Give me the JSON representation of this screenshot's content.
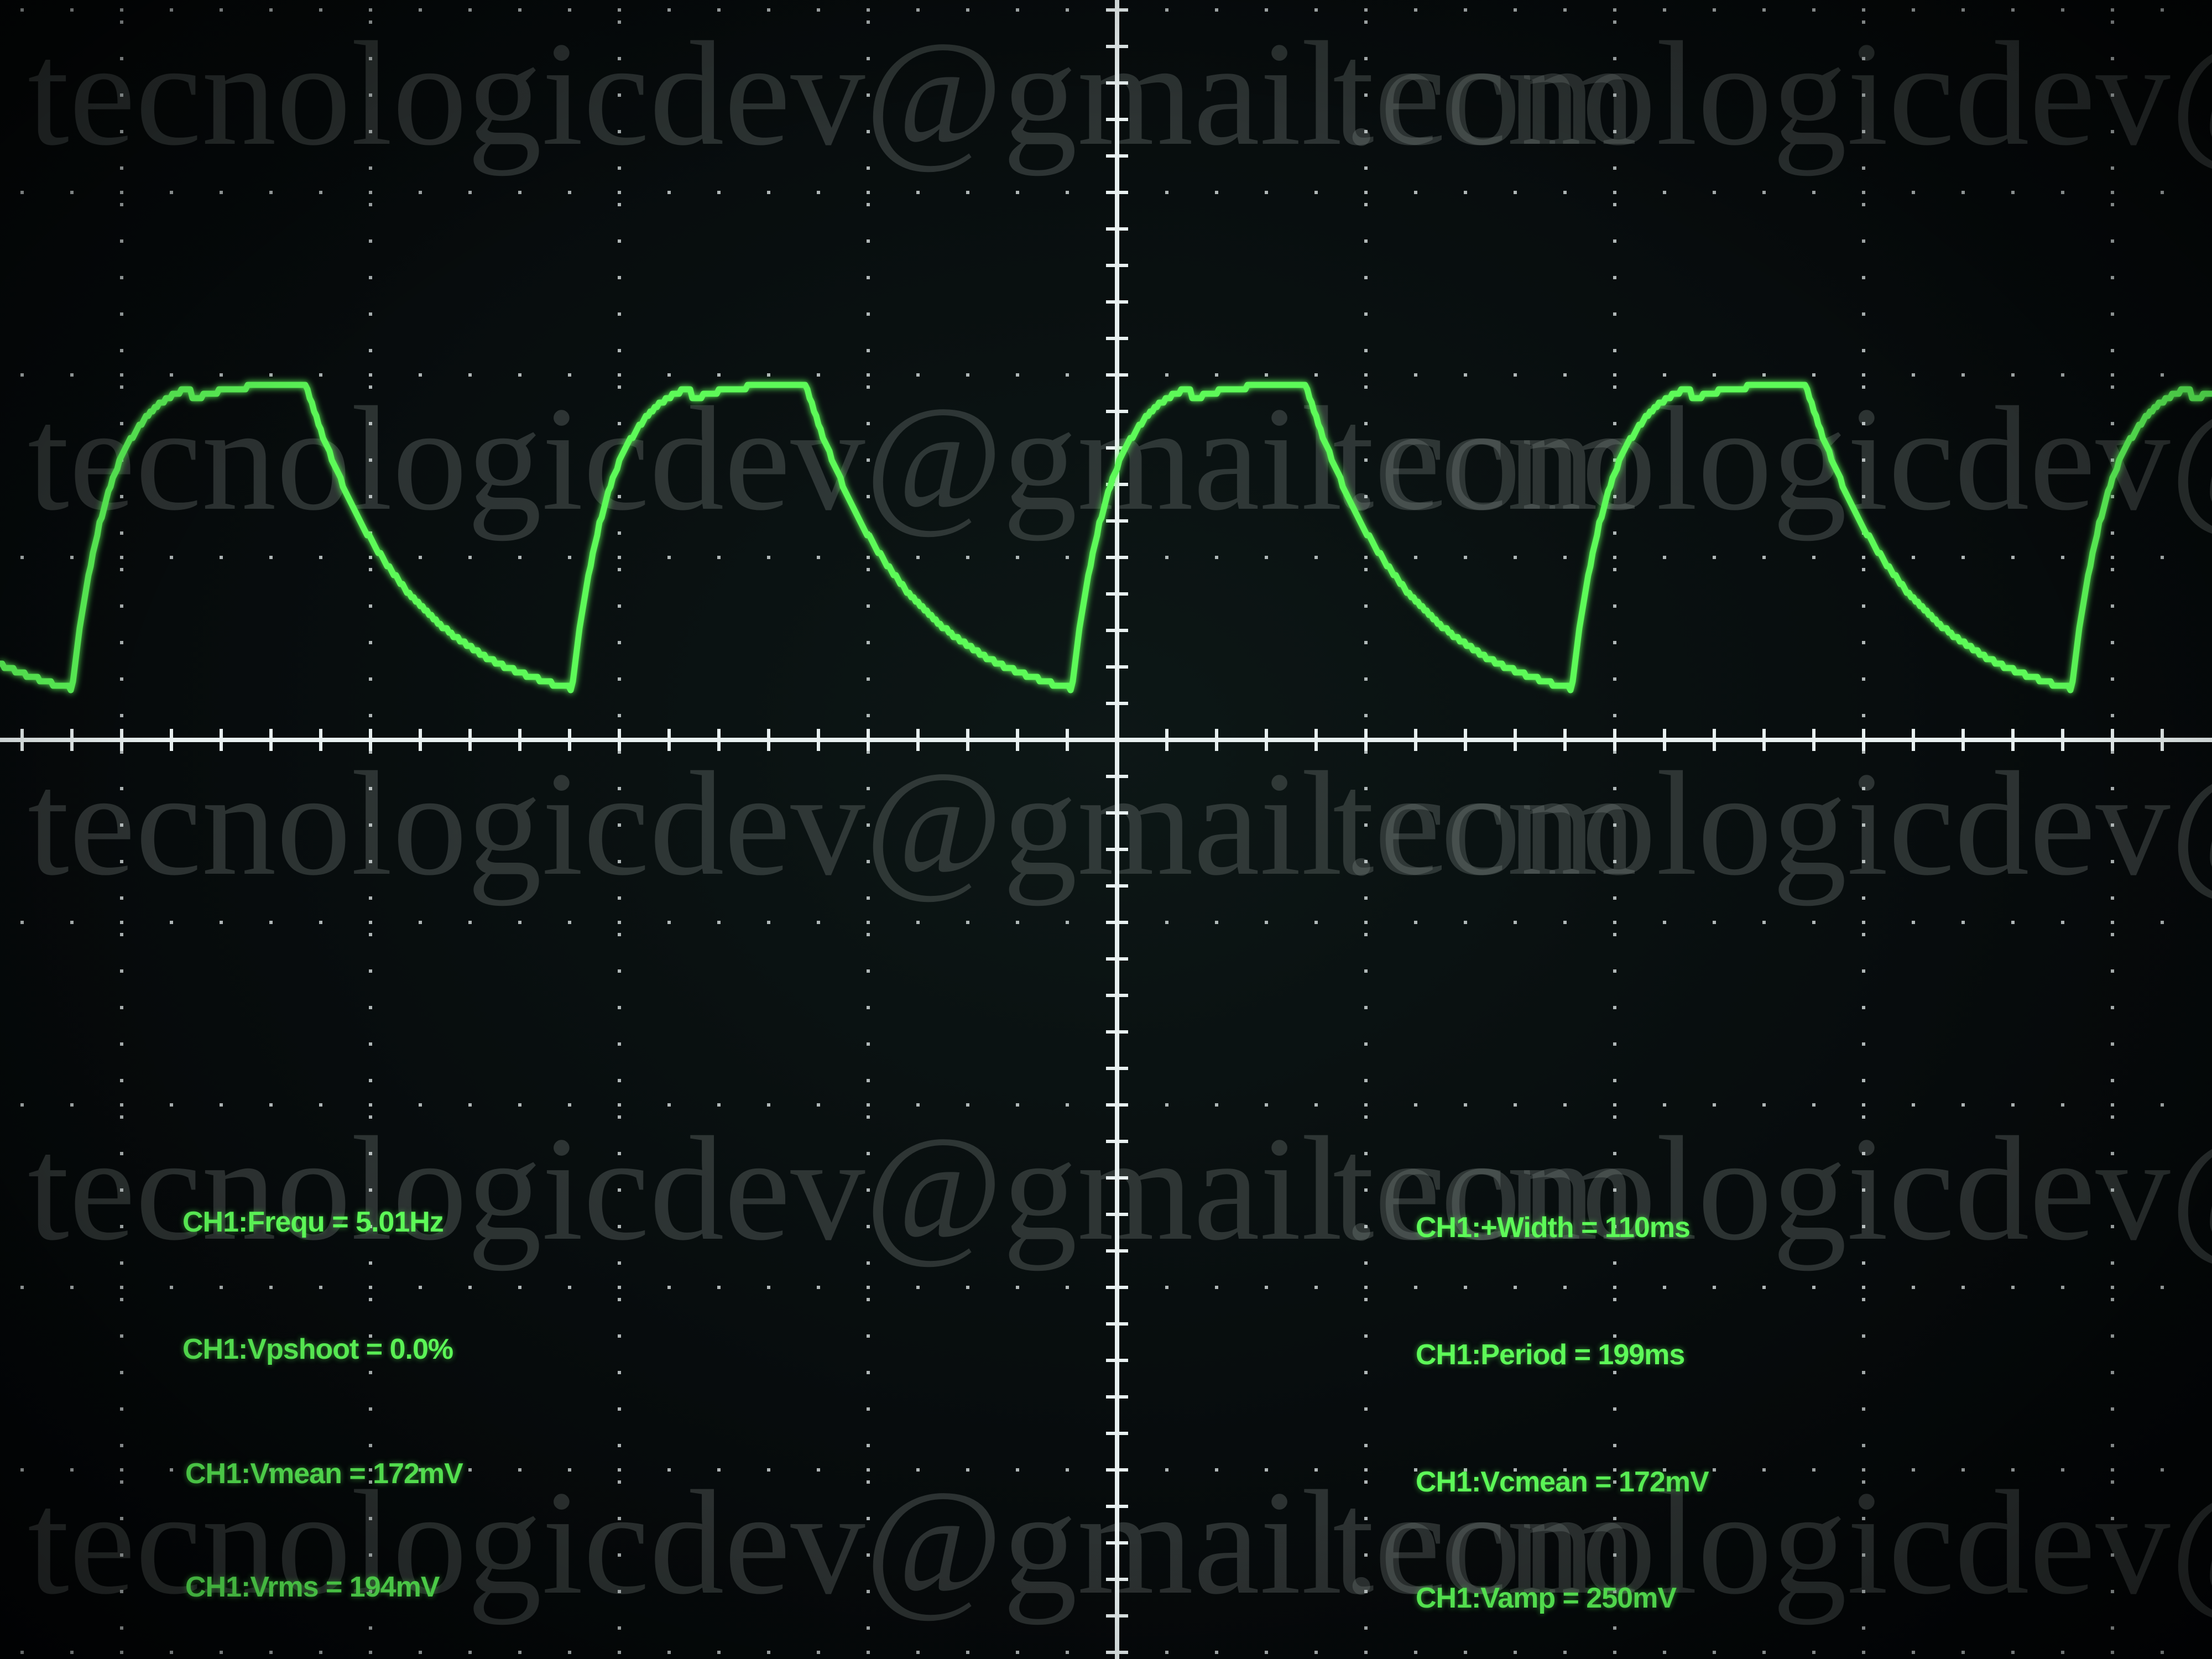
{
  "watermark": {
    "text_left": "tecnologicdev@gmail.com",
    "text_right": "tecnologicdev@gm"
  },
  "measurements": {
    "left": [
      {
        "label": "CH1:Frequ = 5.01Hz"
      },
      {
        "label": "CH1:Vpshoot = 0.0%"
      },
      {
        "label": "CH1:Vmean = 172mV"
      },
      {
        "label": "CH1:Vrms = 194mV"
      }
    ],
    "right": [
      {
        "label": "CH1:+Width = 110ms"
      },
      {
        "label": "CH1:Period = 199ms"
      },
      {
        "label": "CH1:Vcmean = 172mV"
      },
      {
        "label": "CH1:Vamp = 250mV"
      }
    ]
  },
  "colors": {
    "trace": "#5dfa58",
    "graticule": "#e8f0f0",
    "text": "#5dfa58"
  }
}
